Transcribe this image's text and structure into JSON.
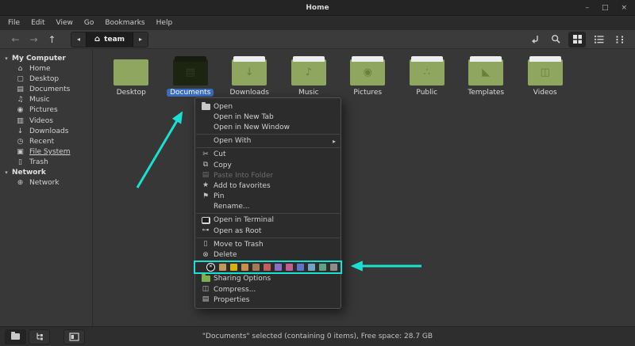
{
  "window": {
    "title": "Home",
    "controls": {
      "minimize": "–",
      "maximize": "□",
      "close": "×"
    }
  },
  "menubar": {
    "items": [
      "File",
      "Edit",
      "View",
      "Go",
      "Bookmarks",
      "Help"
    ]
  },
  "toolbar": {
    "back_glyph": "←",
    "forward_glyph": "→",
    "up_glyph": "↑",
    "breadcrumb": {
      "prev_glyph": "◂",
      "home_glyph": "⌂",
      "label": "team",
      "next_glyph": "▸"
    }
  },
  "sidebar": {
    "expander": "▾",
    "sections": [
      {
        "header": "My Computer",
        "items": [
          {
            "label": "Home",
            "icon": "home-icon",
            "glyph": "⌂"
          },
          {
            "label": "Desktop",
            "icon": "desktop-icon",
            "glyph": "▢"
          },
          {
            "label": "Documents",
            "icon": "document-icon",
            "glyph": "▤"
          },
          {
            "label": "Music",
            "icon": "music-icon",
            "glyph": "♫"
          },
          {
            "label": "Pictures",
            "icon": "camera-icon",
            "glyph": "◉"
          },
          {
            "label": "Videos",
            "icon": "video-icon",
            "glyph": "▥"
          },
          {
            "label": "Downloads",
            "icon": "download-icon",
            "glyph": "↓"
          },
          {
            "label": "Recent",
            "icon": "clock-icon",
            "glyph": "◷"
          },
          {
            "label": "File System",
            "icon": "disk-icon",
            "glyph": "▣",
            "underline": true
          },
          {
            "label": "Trash",
            "icon": "trash-icon",
            "glyph": "▯"
          }
        ]
      },
      {
        "header": "Network",
        "items": [
          {
            "label": "Network",
            "icon": "network-icon",
            "glyph": "⊕"
          }
        ]
      }
    ]
  },
  "files": [
    {
      "name": "Desktop",
      "tab": false
    },
    {
      "name": "Documents",
      "tab": true,
      "glyph": "▤",
      "selected": true
    },
    {
      "name": "Downloads",
      "tab": true,
      "glyph": "↓"
    },
    {
      "name": "Music",
      "tab": true,
      "glyph": "♪"
    },
    {
      "name": "Pictures",
      "tab": true,
      "glyph": "◉"
    },
    {
      "name": "Public",
      "tab": true,
      "glyph": "∴"
    },
    {
      "name": "Templates",
      "tab": true,
      "glyph": "◣"
    },
    {
      "name": "Videos",
      "tab": true,
      "glyph": "◫"
    }
  ],
  "context_menu": {
    "items": [
      {
        "label": "Open",
        "icon": "open-folder-icon",
        "glyph": "@folder"
      },
      {
        "label": "Open in New Tab"
      },
      {
        "label": "Open in New Window"
      },
      {
        "type": "separator"
      },
      {
        "label": "Open With",
        "submenu": true,
        "submenu_arrow": "▸"
      },
      {
        "type": "separator"
      },
      {
        "label": "Cut",
        "icon": "scissors-icon",
        "glyph": "✂"
      },
      {
        "label": "Copy",
        "icon": "copy-icon",
        "glyph": "⧉"
      },
      {
        "label": "Paste Into Folder",
        "icon": "clipboard-icon",
        "glyph": "▤",
        "disabled": true
      },
      {
        "label": "Add to favorites",
        "icon": "star-icon",
        "glyph": "★"
      },
      {
        "label": "Pin",
        "icon": "pin-icon",
        "glyph": "⚑"
      },
      {
        "label": "Rename..."
      },
      {
        "type": "separator"
      },
      {
        "label": "Open in Terminal",
        "icon": "terminal-icon",
        "glyph": "@terminal"
      },
      {
        "label": "Open as Root",
        "icon": "key-icon",
        "glyph": "⊶"
      },
      {
        "type": "separator"
      },
      {
        "label": "Move to Trash",
        "icon": "trash-icon",
        "glyph": "▯"
      },
      {
        "label": "Delete",
        "icon": "delete-circle-icon",
        "glyph": "⊗"
      },
      {
        "type": "colors"
      },
      {
        "label": "Sharing Options",
        "icon": "shared-folder-icon",
        "glyph": "@folder-green"
      },
      {
        "label": "Compress...",
        "icon": "compress-icon",
        "glyph": "◫"
      },
      {
        "label": "Properties",
        "icon": "properties-icon",
        "glyph": "▤"
      }
    ],
    "color_row": {
      "clear_glyph": "✕",
      "swatches": [
        "#c09a5a",
        "#d6b211",
        "#c8904c",
        "#a67a58",
        "#c25e5e",
        "#8a6fc5",
        "#c25e93",
        "#5e74c6",
        "#72a5c3",
        "#5fa183",
        "#8d8d8d"
      ]
    }
  },
  "statusbar": {
    "text": "\"Documents\" selected (containing 0 items), Free space: 28.7 GB"
  },
  "colors": {
    "selection_blue": "#3a6cc0",
    "folder_green": "#8fa660",
    "folder_tab": "#ededed",
    "folder_glyph": "#66803f",
    "selected_folder": "#1c2412",
    "annotation": "#1ae0d2"
  }
}
